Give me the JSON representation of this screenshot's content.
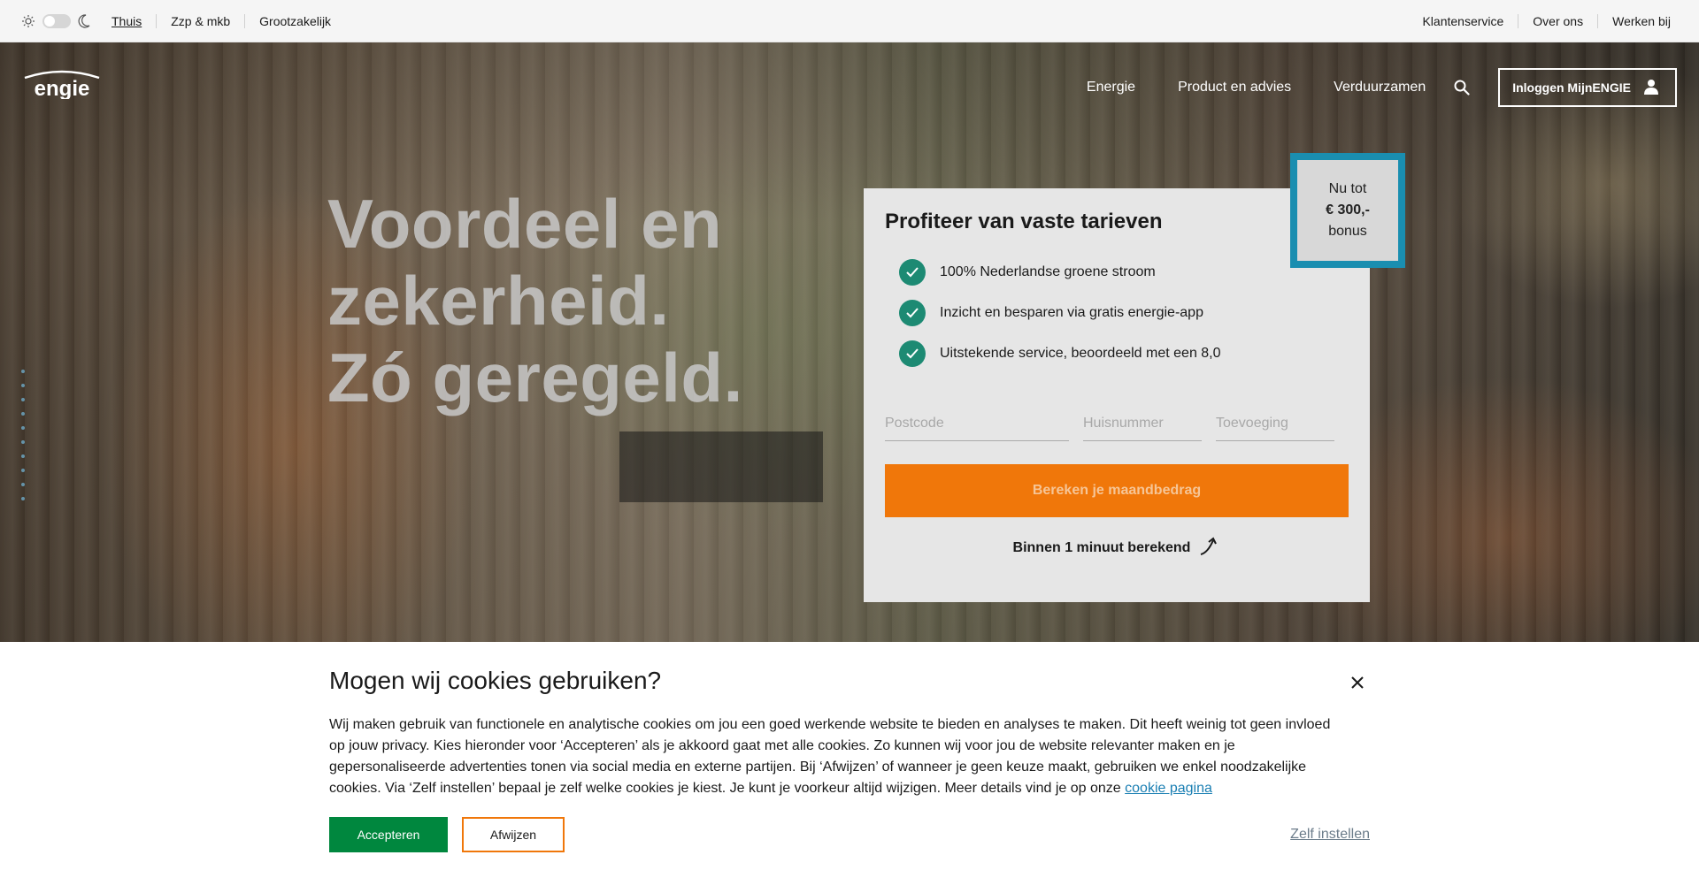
{
  "topbar": {
    "segments": [
      "Thuis",
      "Zzp & mkb",
      "Grootzakelijk"
    ],
    "links": [
      "Klantenservice",
      "Over ons",
      "Werken bij"
    ]
  },
  "header": {
    "logo_text": "engie",
    "nav": [
      "Energie",
      "Product en advies",
      "Verduurzamen"
    ],
    "login_label": "Inloggen MijnENGIE"
  },
  "hero": {
    "headline": "Voordeel en zekerheid. Zó geregeld."
  },
  "offer": {
    "title": "Profiteer van vaste tarieven",
    "benefits": [
      "100% Nederlandse groene stroom",
      "Inzicht en besparen via gratis energie-app",
      "Uitstekende service, beoordeeld met een 8,0"
    ],
    "fields": {
      "postcode_placeholder": "Postcode",
      "huisnummer_placeholder": "Huisnummer",
      "toevoeging_placeholder": "Toevoeging"
    },
    "cta_label": "Bereken je maandbedrag",
    "note": "Binnen 1 minuut berekend"
  },
  "bonus": {
    "line1": "Nu tot",
    "line2": "€ 300,-",
    "line3": "bonus"
  },
  "cookie": {
    "title": "Mogen wij cookies gebruiken?",
    "text": "Wij maken gebruik van functionele en analytische cookies om jou een goed werkende website te bieden en analyses te maken. Dit heeft weinig tot geen invloed op jouw privacy. Kies hieronder voor ‘Accepteren’ als je akkoord gaat met alle cookies. Zo kunnen wij voor jou de website relevanter maken en je gepersonaliseerde advertenties tonen via social media en externe partijen. Bij ‘Afwijzen’ of wanneer je geen keuze maakt, gebruiken we enkel noodzakelijke cookies. Via ‘Zelf instellen’ bepaal je zelf welke cookies je kiest. Je kunt je voorkeur altijd wijzigen. Meer details vind je op onze",
    "link_label": "cookie pagina",
    "accept_label": "Accepteren",
    "reject_label": "Afwijzen",
    "settings_label": "Zelf instellen"
  },
  "colors": {
    "accent_orange": "#f0770a",
    "accept_green": "#00873e",
    "check_teal": "#1d8a73",
    "bonus_border": "#1a8eb0"
  }
}
